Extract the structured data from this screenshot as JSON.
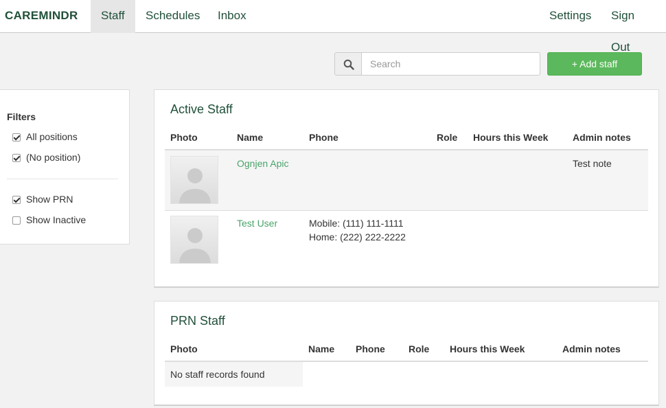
{
  "navbar": {
    "brand": "CAREMINDR",
    "items": [
      {
        "label": "Staff",
        "active": true
      },
      {
        "label": "Schedules",
        "active": false
      },
      {
        "label": "Inbox",
        "active": false
      }
    ],
    "right_items": [
      {
        "label": "Settings"
      },
      {
        "label": "Sign Out"
      }
    ]
  },
  "toolbar": {
    "search_placeholder": "Search",
    "search_icon": "search-icon",
    "add_staff_label": "+ Add staff",
    "add_staff_color": "#5cb85c"
  },
  "filters": {
    "title": "Filters",
    "items": [
      {
        "label": "All positions",
        "checked": true
      },
      {
        "label": "(No position)",
        "checked": true
      },
      {
        "label": "Show PRN",
        "checked": true
      },
      {
        "label": "Show Inactive",
        "checked": false
      }
    ]
  },
  "active_staff": {
    "title": "Active Staff",
    "columns": [
      "Photo",
      "Name",
      "Phone",
      "Role",
      "Hours this Week",
      "Admin notes"
    ],
    "rows": [
      {
        "name": "Ognjen Apic",
        "phone_lines": [
          "",
          ""
        ],
        "role": "",
        "hours": "",
        "notes": "Test note"
      },
      {
        "name": "Test User",
        "phone_lines": [
          "Mobile: (111) 111-1111",
          "Home: (222) 222-2222"
        ],
        "role": "",
        "hours": "",
        "notes": ""
      }
    ]
  },
  "prn_staff": {
    "title": "PRN Staff",
    "columns": [
      "Photo",
      "Name",
      "Phone",
      "Role",
      "Hours this Week",
      "Admin notes"
    ],
    "empty_message": "No staff records found"
  },
  "colors": {
    "brand": "#21503a",
    "link": "#4aa36a",
    "accent": "#5cb85c"
  }
}
